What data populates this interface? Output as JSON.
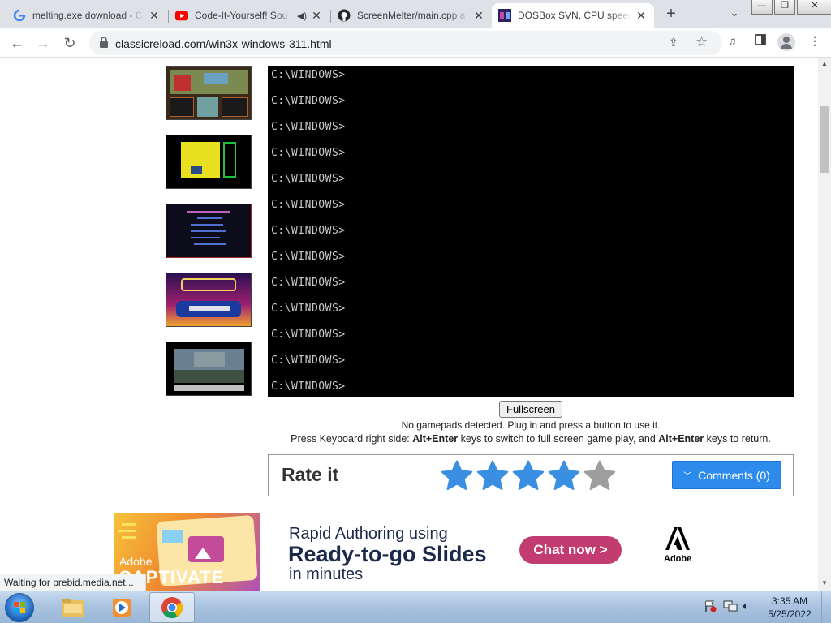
{
  "browser": {
    "tabs": [
      {
        "title": "melting.exe download - C",
        "favicon": "google-g-icon"
      },
      {
        "title": "Code-It-Yourself! Sou",
        "favicon": "youtube-icon",
        "audio": true
      },
      {
        "title": "ScreenMelter/main.cpp a",
        "favicon": "github-icon"
      },
      {
        "title": "DOSBox SVN, CPU speed",
        "favicon": "dosbox-icon",
        "active": true
      }
    ],
    "url": "classicreload.com/win3x-windows-311.html",
    "new_tab_label": "+",
    "window_buttons": {
      "minimize": "—",
      "maximize": "❐",
      "close": "✕"
    }
  },
  "dos": {
    "lines": [
      "C:\\WINDOWS>",
      "C:\\WINDOWS>",
      "C:\\WINDOWS>",
      "C:\\WINDOWS>",
      "C:\\WINDOWS>",
      "C:\\WINDOWS>",
      "C:\\WINDOWS>",
      "C:\\WINDOWS>",
      "C:\\WINDOWS>",
      "C:\\WINDOWS>",
      "C:\\WINDOWS>",
      "C:\\WINDOWS>",
      "C:\\WINDOWS>"
    ]
  },
  "emulator": {
    "fullscreen_label": "Fullscreen",
    "gamepad_note": "No gamepads detected. Plug in and press a button to use it.",
    "kb_prefix": "Press Keyboard right side: ",
    "kb_key1": "Alt+Enter",
    "kb_middle": " keys to switch to full screen game play, and ",
    "kb_key2": "Alt+Enter",
    "kb_suffix": " keys to return."
  },
  "rating": {
    "title": "Rate it",
    "stars_filled": 4,
    "stars_total": 5,
    "comments_label": "Comments (0)",
    "colors": {
      "filled": "#3b8fe3",
      "empty": "#9e9e9e",
      "button": "#2d8ceb"
    }
  },
  "ad": {
    "image_brand": "Adobe",
    "image_product": "CAPTIVATE",
    "line1": "Rapid Authoring using",
    "line2": "Ready-to-go Slides",
    "line3": "in minutes",
    "cta": "Chat now >",
    "logo_text": "Adobe",
    "colors": {
      "cta": "#c23c70",
      "text": "#1b2a4a"
    }
  },
  "status_bar": "Waiting for prebid.media.net...",
  "taskbar": {
    "time": "3:35 AM",
    "date": "5/25/2022",
    "apps": [
      "explorer-icon",
      "media-player-icon",
      "chrome-icon"
    ]
  }
}
